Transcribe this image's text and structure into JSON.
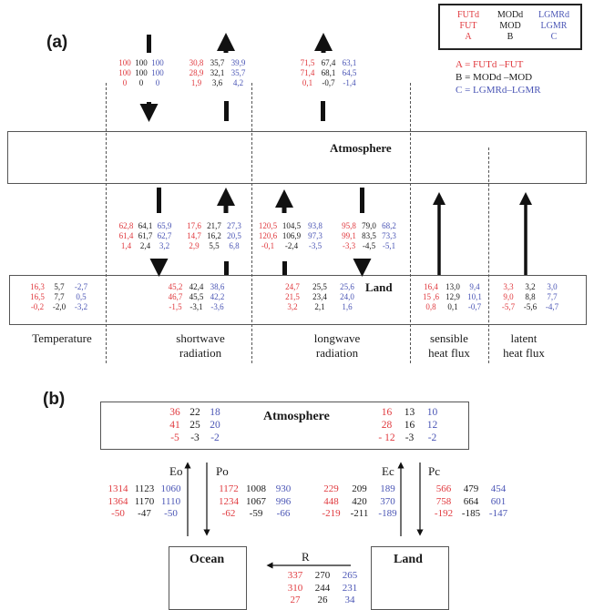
{
  "panel_a": {
    "label": "(a)",
    "legend": {
      "rows": [
        [
          "FUTd",
          "MODd",
          "LGMRd"
        ],
        [
          "FUT",
          "MOD",
          "LGMR"
        ],
        [
          "A",
          "B",
          "C"
        ]
      ],
      "definitions": [
        "A = FUTd –FUT",
        "B = MODd –MOD",
        "C = LGMRd–LGMR"
      ]
    },
    "colors": {
      "FUT": "#e0393e",
      "MOD": "#1a1a1a",
      "LGMR": "#4a55b5"
    },
    "atmosphere_label": "Atmosphere",
    "land_label": "Land",
    "categories": [
      "Temperature",
      "shortwave\nradiation",
      "longwave\nradiation",
      "sensible\nheat flux",
      "latent\nheat flux"
    ],
    "toa_shortwave_down": [
      [
        "100",
        "100",
        "100"
      ],
      [
        "100",
        "100",
        "100"
      ],
      [
        "0",
        "0",
        "0"
      ]
    ],
    "toa_shortwave_up": [
      [
        "30,8",
        "35,7",
        "39,9"
      ],
      [
        "28,9",
        "32,1",
        "35,7"
      ],
      [
        "1,9",
        "3,6",
        "4,2"
      ]
    ],
    "toa_longwave_up": [
      [
        "71,5",
        "67,4",
        "63,1"
      ],
      [
        "71,4",
        "68,1",
        "64,5"
      ],
      [
        "0,1",
        "-0,7",
        "-1,4"
      ]
    ],
    "sfc_shortwave_down": [
      [
        "62,8",
        "64,1",
        "65,9"
      ],
      [
        "61,4",
        "61,7",
        "62,7"
      ],
      [
        "1,4",
        "2,4",
        "3,2"
      ]
    ],
    "sfc_shortwave_up": [
      [
        "17,6",
        "21,7",
        "27,3"
      ],
      [
        "14,7",
        "16,2",
        "20,5"
      ],
      [
        "2,9",
        "5,5",
        "6,8"
      ]
    ],
    "sfc_longwave_up": [
      [
        "120,5",
        "104,5",
        "93,8"
      ],
      [
        "120,6",
        "106,9",
        "97,3"
      ],
      [
        "-0,1",
        "-2,4",
        "-3,5"
      ]
    ],
    "sfc_longwave_down": [
      [
        "95,8",
        "79,0",
        "68,2"
      ],
      [
        "99,1",
        "83,5",
        "73,3"
      ],
      [
        "-3,3",
        "-4,5",
        "-5,1"
      ]
    ],
    "land_temperature": [
      [
        "16,3",
        "5,7",
        "-2,7"
      ],
      [
        "16,5",
        "7,7",
        "0,5"
      ],
      [
        "-0,2",
        "-2,0",
        "-3,2"
      ]
    ],
    "land_shortwave_net": [
      [
        "45,2",
        "42,4",
        "38,6"
      ],
      [
        "46,7",
        "45,5",
        "42,2"
      ],
      [
        "-1,5",
        "-3,1",
        "-3,6"
      ]
    ],
    "land_longwave_net": [
      [
        "24,7",
        "25,5",
        "25,6"
      ],
      [
        "21,5",
        "23,4",
        "24,0"
      ],
      [
        "3,2",
        "2,1",
        "1,6"
      ]
    ],
    "land_sensible": [
      [
        "16,4",
        "13,0",
        "9,4"
      ],
      [
        "15 ,6",
        "12,9",
        "10,1"
      ],
      [
        "0,8",
        "0,1",
        "-0,7"
      ]
    ],
    "land_latent": [
      [
        "3,3",
        "3,2",
        "3,0"
      ],
      [
        "9,0",
        "8,8",
        "7,7"
      ],
      [
        "-5,7",
        "-5,6",
        "-4,7"
      ]
    ]
  },
  "panel_b": {
    "label": "(b)",
    "atmosphere_label": "Atmosphere",
    "ocean_label": "Ocean",
    "land_label": "Land",
    "flux_labels": {
      "Eo": "Eo",
      "Po": "Po",
      "Ec": "Ec",
      "Pc": "Pc",
      "R": "R"
    },
    "atm_left": [
      [
        "36",
        "22",
        "18"
      ],
      [
        "41",
        "25",
        "20"
      ],
      [
        "-5",
        "-3",
        "-2"
      ]
    ],
    "atm_right": [
      [
        "16",
        "13",
        "10"
      ],
      [
        "28",
        "16",
        "12"
      ],
      [
        "- 12",
        "-3",
        "-2"
      ]
    ],
    "Eo": [
      [
        "1314",
        "1123",
        "1060"
      ],
      [
        "1364",
        "1170",
        "1110"
      ],
      [
        "-50",
        "-47",
        "-50"
      ]
    ],
    "Po": [
      [
        "1172",
        "1008",
        "930"
      ],
      [
        "1234",
        "1067",
        "996"
      ],
      [
        "-62",
        "-59",
        "-66"
      ]
    ],
    "Ec": [
      [
        "229",
        "209",
        "189"
      ],
      [
        "448",
        "420",
        "370"
      ],
      [
        "-219",
        "-211",
        "-189"
      ]
    ],
    "Pc": [
      [
        "566",
        "479",
        "454"
      ],
      [
        "758",
        "664",
        "601"
      ],
      [
        "-192",
        "-185",
        "-147"
      ]
    ],
    "R": [
      [
        "337",
        "270",
        "265"
      ],
      [
        "310",
        "244",
        "231"
      ],
      [
        "27",
        "26",
        "34"
      ]
    ]
  }
}
